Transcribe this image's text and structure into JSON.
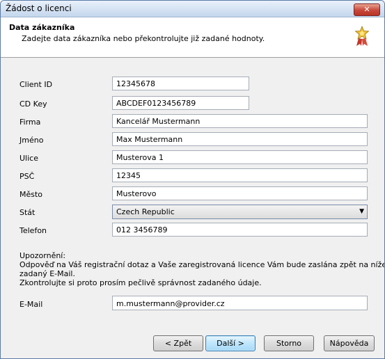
{
  "window": {
    "title": "Žádost o licenci",
    "close_label": "✕"
  },
  "header": {
    "title": "Data zákazníka",
    "subtitle": "Zadejte data zákazníka nebo překontrolujte již zadané hodnoty."
  },
  "form": {
    "client_id": {
      "label": "Client ID",
      "value": "12345678"
    },
    "cd_key": {
      "label": "CD Key",
      "value": "ABCDEF0123456789"
    },
    "firma": {
      "label": "Firma",
      "value": "Kancelář Mustermann"
    },
    "jmeno": {
      "label": "Jméno",
      "value": "Max Mustermann"
    },
    "ulice": {
      "label": "Ulice",
      "value": "Musterova 1"
    },
    "psc": {
      "label": "PSČ",
      "value": "12345"
    },
    "mesto": {
      "label": "Město",
      "value": "Musterovo"
    },
    "stat": {
      "label": "Stát",
      "value": "Czech Republic"
    },
    "telefon": {
      "label": "Telefon",
      "value": "012 3456789"
    },
    "email": {
      "label": "E-Mail",
      "value": "m.mustermann@provider.cz"
    }
  },
  "notice": {
    "heading": "Upozornění:",
    "line1": "Odpověď na Váš registrační dotaz a Vaše zaregistrovaná licence Vám bude zaslána zpět na níže",
    "line2": "zadaný E-Mail.",
    "line3": "Zkontrolujte si proto prosím pečlivě správnost zadaného údaje."
  },
  "buttons": {
    "back": "< Zpět",
    "next": "Další >",
    "cancel": "Storno",
    "help": "Nápověda"
  },
  "icons": {
    "header_badge": "gold-star-badge-icon",
    "dropdown": "chevron-down-icon"
  }
}
